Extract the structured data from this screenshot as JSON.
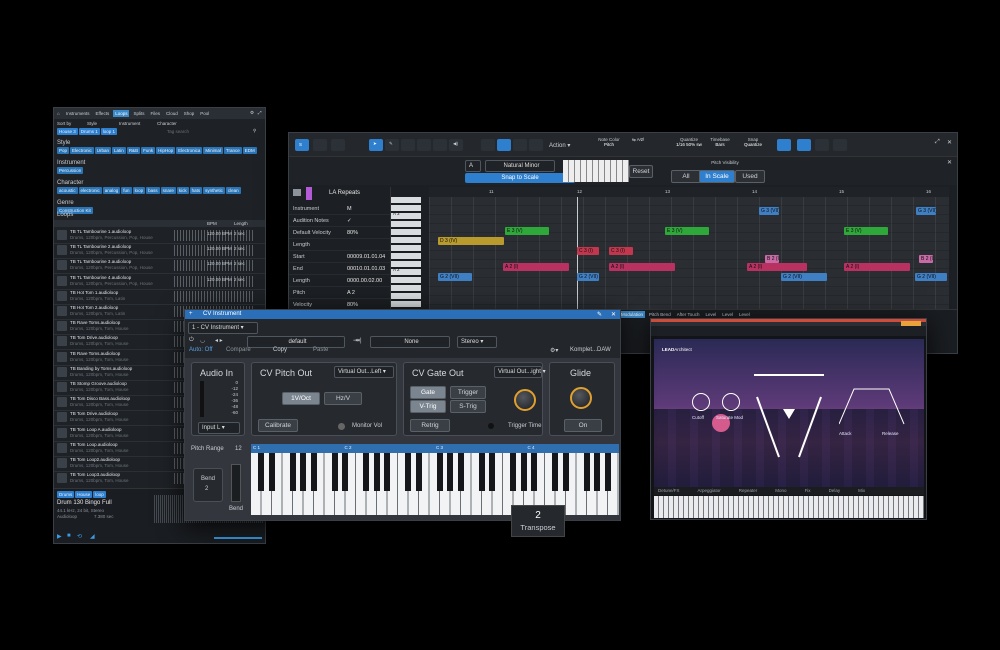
{
  "browser": {
    "tabs": [
      "Instruments",
      "Effects",
      "Loops",
      "Splits",
      "Files",
      "Cloud",
      "Shop",
      "Pool"
    ],
    "active_tab": "Loops",
    "filter_chips": [
      "House 3",
      "Drums 1",
      "loop 1"
    ],
    "sort_labels": [
      "Sort by",
      "Style",
      "Instrument",
      "Character"
    ],
    "search_placeholder": "Tag search",
    "style_label": "Style",
    "style_tags": [
      "Pop",
      "Electronic",
      "Urban",
      "Latin",
      "R&B",
      "Funk",
      "HipHop",
      "Electronica",
      "Minimal",
      "Trance",
      "EDM"
    ],
    "instrument_label": "Instrument",
    "instrument_tags": [
      "Percussion"
    ],
    "character_label": "Character",
    "character_tags": [
      "acoustic",
      "electronic",
      "analog",
      "fun",
      "loop",
      "bass",
      "snare",
      "kick",
      "hats",
      "synthetic",
      "clean"
    ],
    "genre_label": "Genre",
    "genre_tags": [
      "Construction Kit"
    ],
    "loops_label": "Loops",
    "col_bpm": "BPM",
    "col_length": "Length",
    "loops": [
      {
        "name": "TB TL Tambourine 1.audioloop",
        "sub": "Drums, 120bpm, Percussion, Pop, House",
        "bpm": "120.00 BPM",
        "len": "2 sec"
      },
      {
        "name": "TB TL Tambourine 2.audioloop",
        "sub": "Drums, 120bpm, Percussion, Pop, House",
        "bpm": "120.00 BPM",
        "len": "2 sec"
      },
      {
        "name": "TB TL Tambourine 3.audioloop",
        "sub": "Drums, 120bpm, Percussion, Pop, House",
        "bpm": "120.00 BPM",
        "len": "2 sec"
      },
      {
        "name": "TB TL Tambourine 4.audioloop",
        "sub": "Drums, 120bpm, Percussion, Pop, House",
        "bpm": "120.00 BPM",
        "len": "2 sec"
      },
      {
        "name": "TB Hot Tom 1.audioloop",
        "sub": "Drums, 120bpm, Tom, Latin",
        "bpm": "",
        "len": ""
      },
      {
        "name": "TB Hot Tom 2.audioloop",
        "sub": "Drums, 120bpm, Tom, Latin",
        "bpm": "",
        "len": ""
      },
      {
        "name": "TB Rave Toms.audioloop",
        "sub": "Drums, 120bpm, Tom, House",
        "bpm": "",
        "len": ""
      },
      {
        "name": "TB Tom Drive.audioloop",
        "sub": "Drums, 120bpm, Tom, House",
        "bpm": "",
        "len": ""
      },
      {
        "name": "TB Rave Toms.audioloop",
        "sub": "Drums, 120bpm, Tom, House",
        "bpm": "",
        "len": ""
      },
      {
        "name": "TB Banding by Toms.audioloop",
        "sub": "Drums, 120bpm, Tom, House",
        "bpm": "",
        "len": ""
      },
      {
        "name": "TB Stomp Groove.audioloop",
        "sub": "Drums, 120bpm, Tom, House",
        "bpm": "",
        "len": ""
      },
      {
        "name": "TB Tom Disco Bass.audioloop",
        "sub": "Drums, 120bpm, Tom, House",
        "bpm": "",
        "len": ""
      },
      {
        "name": "TB Tom Drive.audioloop",
        "sub": "Drums, 120bpm, Tom, House",
        "bpm": "",
        "len": ""
      },
      {
        "name": "TB Tom Loop A.audioloop",
        "sub": "Drums, 120bpm, Tom, House",
        "bpm": "",
        "len": ""
      },
      {
        "name": "TB Tom Loop.audioloop",
        "sub": "Drums, 120bpm, Tom, House",
        "bpm": "",
        "len": ""
      },
      {
        "name": "TB Tom Loop2.audioloop",
        "sub": "Drums, 120bpm, Tom, House",
        "bpm": "",
        "len": ""
      },
      {
        "name": "TB Tom Loop3.audioloop",
        "sub": "Drums, 120bpm, Tom, House",
        "bpm": "",
        "len": ""
      }
    ],
    "footer_tags": [
      "Drums",
      "House",
      "loop"
    ],
    "preview_name": "Drum 130 Bingo Full",
    "preview_meta": "44.1 kHz, 24 bit, Stereo",
    "preview_type": "Audioloop",
    "preview_size": "7.380 sec"
  },
  "roll": {
    "note_color_label": "Note Color",
    "note_color_value": "Pitch",
    "quantize_label": "Quantize",
    "quantize_value": "1/16 50% sw",
    "timebase_label": "Timebase",
    "timebase_value": "Bars",
    "snap_label": "Snap",
    "snap_value": "Quantize",
    "action_label": "Action",
    "scale_root": "A",
    "scale_name": "Natural Minor",
    "snap_to_scale": "Snap to Scale",
    "reset": "Reset",
    "pitch_visibility": "Pitch Visibility",
    "vis_all": "All",
    "vis_in_scale": "In Scale",
    "vis_used": "Used",
    "track_name": "LA Repeats",
    "inspector": [
      {
        "label": "Instrument",
        "value": "M"
      },
      {
        "label": "Audition Notes",
        "value": "✓"
      },
      {
        "label": "Default Velocity",
        "value": "80%"
      },
      {
        "label": "Length",
        "value": ""
      },
      {
        "label": "Start",
        "value": "00009.01.01.04"
      },
      {
        "label": "End",
        "value": "00010.01.01.03"
      },
      {
        "label": "Length",
        "value": "0000.00.02.00"
      },
      {
        "label": "Pitch",
        "value": "A 2"
      },
      {
        "label": "Velocity",
        "value": "80%"
      }
    ],
    "bars": [
      "11",
      "12",
      "13",
      "14",
      "15",
      "16"
    ],
    "lane_tabs": [
      "Modulation",
      "Pitch Bend",
      "After Touch",
      "Level",
      "Level",
      "Level"
    ],
    "notes": [
      {
        "label": "G 3 (VII)",
        "color": "#3f7fc4"
      },
      {
        "label": "G 3 (VII)",
        "color": "#3f7fc4"
      },
      {
        "label": "E 3 (V)",
        "color": "#2fa83a"
      },
      {
        "label": "E 3 (V)",
        "color": "#2fa83a"
      },
      {
        "label": "E 3 (V)",
        "color": "#2fa83a"
      },
      {
        "label": "D 3 (IV)",
        "color": "#b99a2c"
      },
      {
        "label": "C 3 (I)",
        "color": "#c2374d"
      },
      {
        "label": "C 3 (I)",
        "color": "#c2374d"
      },
      {
        "label": "B 2 (II)",
        "color": "#c76aa6"
      },
      {
        "label": "B 2 (II)",
        "color": "#c76aa6"
      },
      {
        "label": "A 2 (I)",
        "color": "#b83160"
      },
      {
        "label": "A 2 (I)",
        "color": "#b83160"
      },
      {
        "label": "A 2 (I)",
        "color": "#b83160"
      },
      {
        "label": "A 2 (I)",
        "color": "#b83160"
      },
      {
        "label": "G 2 (VII)",
        "color": "#3f7fc4"
      },
      {
        "label": "G 2 (VII)",
        "color": "#3f7fc4"
      },
      {
        "label": "G 2 (VII)",
        "color": "#3f7fc4"
      },
      {
        "label": "G 2 (VII)",
        "color": "#3f7fc4"
      }
    ]
  },
  "cv": {
    "title": "CV Instrument",
    "instance": "1 - CV Instrument",
    "preset": "default",
    "auto": "Auto: Off",
    "compare": "Compare",
    "copy": "Copy",
    "paste": "Paste",
    "sidechain": "None",
    "output_mode": "Stereo",
    "device": "Komplet...DAW",
    "audio_in": "Audio In",
    "meter_scale": [
      "0",
      "-12",
      "-24",
      "-36",
      "-48",
      "-60"
    ],
    "input_sel": "Input L",
    "pitch_out": "CV Pitch Out",
    "pitch_dest": "Virtual Out...Left",
    "v_oct": "1V/Oct",
    "hz_v": "Hz/V",
    "calibrate": "Calibrate",
    "monitor": "Monitor Vol",
    "gate_out": "CV Gate Out",
    "gate_dest": "Virtual Out...ight",
    "gate": "Gate",
    "trigger": "Trigger",
    "vtrig": "V-Trig",
    "strig": "S-Trig",
    "retrig": "Retrig",
    "trigger_time": "Trigger Time",
    "glide": "Glide",
    "glide_on": "On",
    "pitch_range_label": "Pitch Range",
    "pitch_range_value": "12",
    "bend_label": "Bend",
    "bend_value": "2",
    "bend_slider": "Bend",
    "octaves": [
      "C 1",
      "C 2",
      "C 3",
      "C 4"
    ],
    "transpose_value": "2",
    "transpose_label": "Transpose"
  },
  "lead": {
    "title": "LEADarchitect",
    "brand": "LEAD",
    "sub": "Architect",
    "ctl_labels": [
      "Cutoff",
      "Saturate Mod",
      "Attack",
      "Release"
    ],
    "bottom_tabs": [
      "Detune/FX",
      "Arpeggiator",
      "Repeater",
      "Mono",
      "Fix",
      "Delay",
      "Mix"
    ],
    "accent": "#e8a33a"
  },
  "colors": {
    "accent": "#2f7fcf",
    "knob_ring": "#e0a030"
  }
}
